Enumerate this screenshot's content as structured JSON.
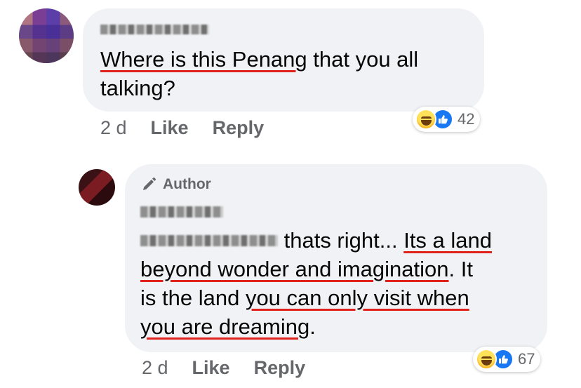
{
  "comments": [
    {
      "text_lines": [
        {
          "segments": [
            {
              "t": "Where is this Penang",
              "underline": true
            },
            {
              "t": " that you all",
              "underline": false
            }
          ]
        },
        {
          "segments": [
            {
              "t": "talking?",
              "underline": false
            }
          ]
        }
      ],
      "actions": {
        "time": "2 d",
        "like": "Like",
        "reply": "Reply"
      },
      "reactions": {
        "icons": [
          "haha-icon",
          "like-icon"
        ],
        "count": "42"
      }
    },
    {
      "author_badge": "Author",
      "text_lines": [
        {
          "segments": [
            {
              "t": " thats right... ",
              "underline": false
            },
            {
              "t": "Its a land",
              "underline": true
            }
          ]
        },
        {
          "segments": [
            {
              "t": "beyond wonder and imagination",
              "underline": true
            },
            {
              "t": ". It",
              "underline": false
            }
          ]
        },
        {
          "segments": [
            {
              "t": "is the land ",
              "underline": false
            },
            {
              "t": "you can only visit when",
              "underline": true
            }
          ]
        },
        {
          "segments": [
            {
              "t": "you are dreaming",
              "underline": true
            },
            {
              "t": ".",
              "underline": false
            }
          ]
        }
      ],
      "actions": {
        "time": "2 d",
        "like": "Like",
        "reply": "Reply"
      },
      "reactions": {
        "icons": [
          "haha-icon",
          "like-icon"
        ],
        "count": "67"
      }
    }
  ],
  "colors": {
    "bubble": "#f0f2f5",
    "underline": "#e0211c",
    "meta": "#65676b",
    "like_blue": "#1877f2"
  }
}
